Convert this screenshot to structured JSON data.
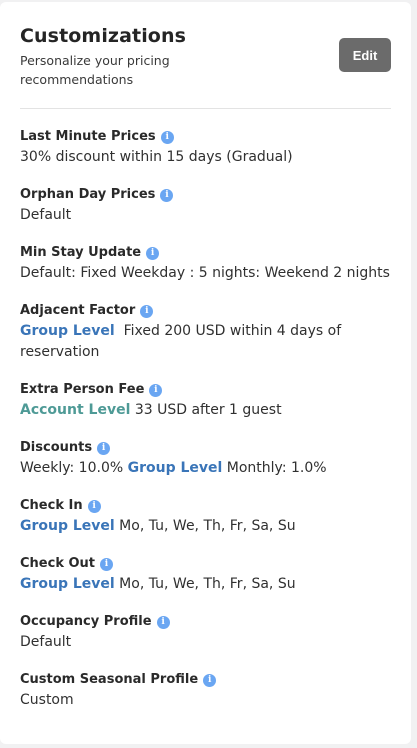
{
  "header": {
    "title": "Customizations",
    "subtitle": "Personalize your pricing recommendations",
    "edit_label": "Edit"
  },
  "icons": {
    "info": "info-icon"
  },
  "colors": {
    "group_level": "#3a75b8",
    "account_level": "#4e9a96",
    "info_icon": "#6aa6f2",
    "edit_button": "#6b6b6b"
  },
  "items": {
    "last_minute": {
      "label": "Last Minute Prices",
      "value": "30% discount within 15 days (Gradual)"
    },
    "orphan_day": {
      "label": "Orphan Day Prices",
      "value": "Default"
    },
    "min_stay": {
      "label": "Min Stay Update",
      "value": "Default: Fixed Weekday : 5 nights: Weekend 2 nights"
    },
    "adjacent": {
      "label": "Adjacent Factor",
      "level": "Group Level",
      "value": "Fixed 200 USD within 4 days of reservation"
    },
    "extra_person": {
      "label": "Extra Person Fee",
      "level": "Account Level",
      "value": "33 USD after 1 guest"
    },
    "discounts": {
      "label": "Discounts",
      "value_pre": "Weekly: 10.0%",
      "level": "Group Level",
      "value_post": "Monthly: 1.0%"
    },
    "check_in": {
      "label": "Check In",
      "level": "Group Level",
      "value": "Mo, Tu, We, Th, Fr, Sa, Su"
    },
    "check_out": {
      "label": "Check Out",
      "level": "Group Level",
      "value": "Mo, Tu, We, Th, Fr, Sa, Su"
    },
    "occupancy": {
      "label": "Occupancy Profile",
      "value": "Default"
    },
    "seasonal": {
      "label": "Custom Seasonal Profile",
      "value": "Custom"
    }
  }
}
